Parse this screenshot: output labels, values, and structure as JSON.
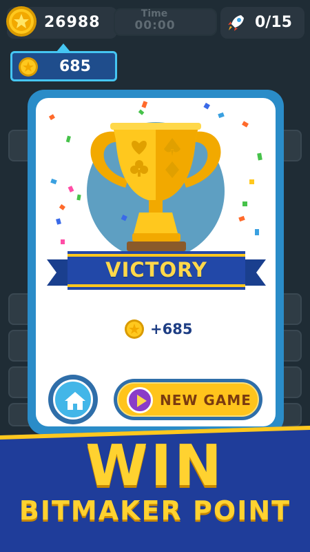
{
  "header": {
    "coins": "26988",
    "timer_label": "Time",
    "timer_value": "00:00",
    "rockets": "0/15"
  },
  "earned_tooltip": {
    "value": "685"
  },
  "dialog": {
    "title": "VICTORY",
    "reward": "+685",
    "new_game_label": "NEW GAME"
  },
  "banner": {
    "headline": "WIN",
    "subline": "BITMAKER POINT"
  },
  "colors": {
    "dialog_border": "#2a8cc8",
    "ribbon": "#2248a8",
    "gold": "#ffd230",
    "banner_bg": "#1f3d9a"
  },
  "icons": [
    "coin-icon",
    "rocket-icon",
    "trophy-icon",
    "home-icon",
    "play-icon"
  ]
}
